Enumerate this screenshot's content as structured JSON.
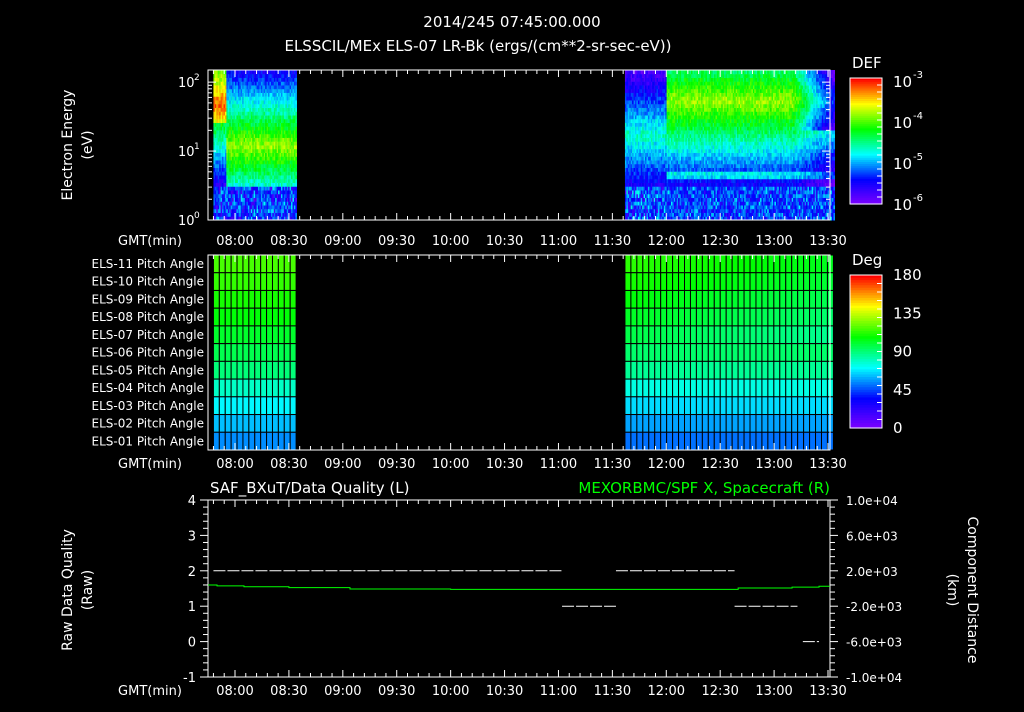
{
  "header": {
    "date_time": "2014/245 07:45:00.000",
    "subtitle": "ELSSCIL/MEx ELS-07 LR-Bk  (ergs/(cm**2-sr-sec-eV))"
  },
  "time_axis": {
    "label": "GMT(min)",
    "ticks": [
      "08:00",
      "08:30",
      "09:00",
      "09:30",
      "10:00",
      "10:30",
      "11:00",
      "11:30",
      "12:00",
      "12:30",
      "13:00",
      "13:30"
    ]
  },
  "chart_data": [
    {
      "type": "heatmap",
      "name": "electron-spectrogram",
      "ylabel": "Electron Energy (eV)",
      "ylabel_lines": [
        "Electron Energy",
        "(eV)"
      ],
      "yscale": "log",
      "ylim": [
        1,
        150
      ],
      "yticks": [
        {
          "base": "10",
          "exp": "0",
          "value": 1
        },
        {
          "base": "10",
          "exp": "1",
          "value": 10
        },
        {
          "base": "10",
          "exp": "2",
          "value": 100
        }
      ],
      "colorbar": {
        "title": "DEF",
        "scale": "log",
        "range": [
          1e-06,
          0.001
        ],
        "ticks": [
          {
            "base": "10",
            "exp": "-3"
          },
          {
            "base": "10",
            "exp": "-4"
          },
          {
            "base": "10",
            "exp": "-5"
          },
          {
            "base": "10",
            "exp": "-6"
          }
        ]
      },
      "data_intervals_min": [
        [
          468,
          514
        ],
        [
          697,
          813
        ]
      ],
      "xlim_min": [
        465,
        811
      ]
    },
    {
      "type": "heatmap",
      "name": "pitch-angle",
      "rows": [
        "ELS-11 Pitch Angle",
        "ELS-10 Pitch Angle",
        "ELS-09 Pitch Angle",
        "ELS-08 Pitch Angle",
        "ELS-07 Pitch Angle",
        "ELS-06 Pitch Angle",
        "ELS-05 Pitch Angle",
        "ELS-04 Pitch Angle",
        "ELS-03 Pitch Angle",
        "ELS-02 Pitch Angle",
        "ELS-01 Pitch Angle"
      ],
      "values_deg": [
        118,
        115,
        111,
        107,
        102,
        97,
        91,
        80,
        71,
        63,
        56
      ],
      "colorbar": {
        "title": "Deg",
        "range": [
          0,
          180
        ],
        "ticks": [
          "180",
          "135",
          "90",
          "45",
          "0"
        ]
      },
      "data_intervals_min": [
        [
          468,
          514
        ],
        [
          697,
          813
        ]
      ]
    },
    {
      "type": "line",
      "name": "data-quality",
      "title_left": "SAF_BXuT/Data Quality (L)",
      "title_right": "MEXORBMC/SPF X, Spacecraft (R)",
      "ylabel_left": [
        "Raw Data Quality",
        "(Raw)"
      ],
      "ylabel_right": [
        "Component Distance",
        "(km)"
      ],
      "ylim_left": [
        -1,
        4
      ],
      "yticks_left": [
        "4",
        "3",
        "2",
        "1",
        "0",
        "-1"
      ],
      "ylim_right": [
        -10000,
        10000
      ],
      "yticks_right": [
        "1.0e+04",
        "6.0e+03",
        "2.0e+03",
        "-2.0e+03",
        "-6.0e+03",
        "-1.0e+04"
      ],
      "quality_segments": [
        {
          "start": 468,
          "end": 662,
          "value": 2
        },
        {
          "start": 662,
          "end": 692,
          "value": 1
        },
        {
          "start": 692,
          "end": 758,
          "value": 2
        },
        {
          "start": 758,
          "end": 793,
          "value": 1
        },
        {
          "start": 796,
          "end": 805,
          "value": 0
        }
      ],
      "spacecraft_x_km": {
        "t": [
          465,
          470,
          485,
          510,
          544,
          600,
          650,
          700,
          750,
          760,
          790,
          805,
          811
        ],
        "v": [
          400,
          300,
          200,
          100,
          -50,
          -100,
          -100,
          -100,
          -100,
          50,
          150,
          250,
          400
        ]
      },
      "colors": {
        "quality": "#ffffff",
        "spacecraft": "#00ff00"
      }
    }
  ]
}
